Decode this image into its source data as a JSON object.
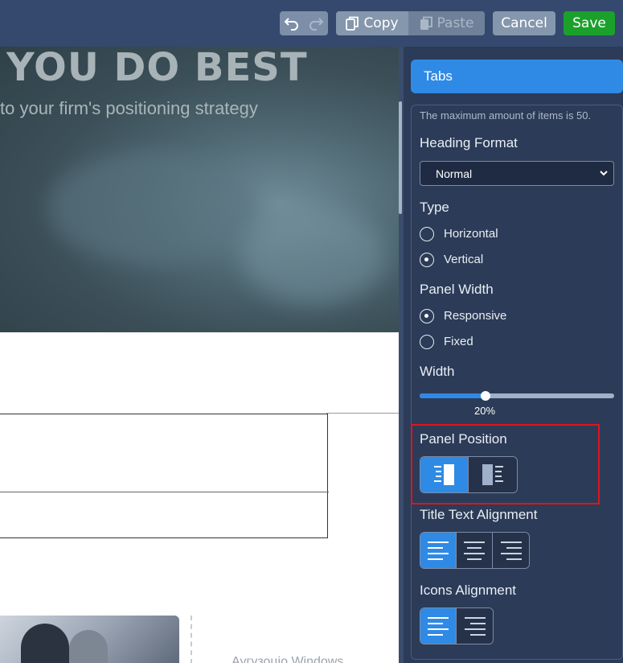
{
  "toolbar": {
    "copy_label": "Copy",
    "paste_label": "Paste",
    "cancel_label": "Cancel",
    "save_label": "Save",
    "colors": {
      "save": "#1ba12b",
      "accent": "#2f8ae5"
    }
  },
  "canvas": {
    "hero_title": "YOU DO BEST",
    "hero_subtitle": "to your firm's positioning strategy",
    "caption": "Аугузоціо Windows"
  },
  "panel": {
    "header": "Tabs",
    "note": "The maximum amount of items is 50.",
    "heading_format": {
      "label": "Heading Format",
      "value": "Normal"
    },
    "type": {
      "label": "Type",
      "options": [
        "Horizontal",
        "Vertical"
      ],
      "selected": "Vertical"
    },
    "panel_width": {
      "label": "Panel Width",
      "options": [
        "Responsive",
        "Fixed"
      ],
      "selected": "Responsive"
    },
    "width": {
      "label": "Width",
      "value": 20,
      "display": "20%"
    },
    "panel_position": {
      "label": "Panel Position",
      "options": [
        "left",
        "right"
      ],
      "selected": "left"
    },
    "title_text_alignment": {
      "label": "Title Text Alignment",
      "options": [
        "left",
        "center",
        "right"
      ],
      "selected": "left"
    },
    "icons_alignment": {
      "label": "Icons Alignment",
      "options": [
        "left",
        "right"
      ],
      "selected": "left"
    }
  }
}
